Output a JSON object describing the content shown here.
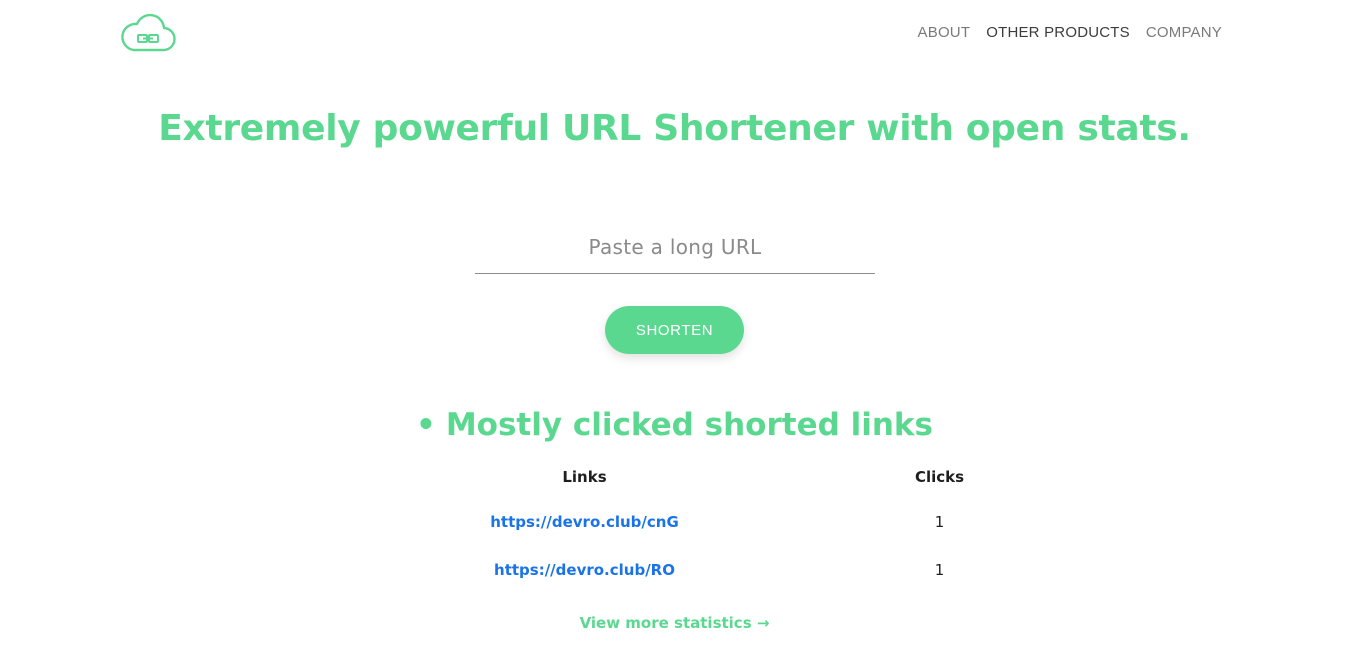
{
  "header": {
    "logo_icon": "cloud-link-icon",
    "nav": [
      {
        "label": "ABOUT"
      },
      {
        "label": "OTHER PRODUCTS"
      },
      {
        "label": "COMPANY"
      }
    ]
  },
  "hero": {
    "headline": "Extremely powerful URL Shortener with open stats.",
    "input_placeholder": "Paste a long URL",
    "input_value": "",
    "button_label": "SHORTEN"
  },
  "stats": {
    "bullet": "•",
    "title": "Mostly clicked shorted links",
    "columns": {
      "links": "Links",
      "clicks": "Clicks"
    },
    "rows": [
      {
        "link": "https://devro.club/cnG",
        "clicks": "1"
      },
      {
        "link": "https://devro.club/RO",
        "clicks": "1"
      }
    ],
    "more_label": "View more statistics →"
  },
  "colors": {
    "accent": "#5bd88f",
    "link": "#1a73e8",
    "nav_text": "#7a7a7a"
  }
}
